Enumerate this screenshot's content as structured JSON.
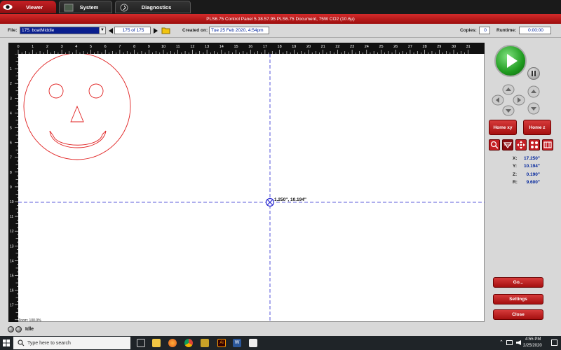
{
  "tabs": [
    {
      "label": "Viewer"
    },
    {
      "label": "System"
    },
    {
      "label": "Diagnostics"
    }
  ],
  "title": "PLS6.75  Control Panel   5.38.57.95     PLS6.75 Document, 75W CO2 (10.6μ)",
  "infobar": {
    "file_label": "File:",
    "file_value": "175. boatMiddle",
    "page_value": "175 of 175",
    "created_label": "Created on:",
    "created_value": "Tue 25 Feb 2020,  4:54pm",
    "copies_label": "Copies:",
    "copies_value": "0",
    "runtime_label": "Runtime:",
    "runtime_value": "0:00:00"
  },
  "ruler_h": [
    "0",
    "1",
    "2",
    "3",
    "4",
    "5",
    "6",
    "7",
    "8",
    "9",
    "10",
    "11",
    "12",
    "13",
    "14",
    "15",
    "16",
    "17",
    "18",
    "19",
    "20",
    "21",
    "22",
    "23",
    "24",
    "25",
    "26",
    "27",
    "28",
    "29",
    "30",
    "31"
  ],
  "ruler_v": [
    "1",
    "2",
    "3",
    "4",
    "5",
    "6",
    "7",
    "8",
    "9",
    "10",
    "11",
    "12",
    "13",
    "14",
    "15",
    "16",
    "17"
  ],
  "cursor_label": "1.250\", 10.194\"",
  "zoom_label": "Zoom:  100.0%",
  "status": "Idle",
  "buttons": {
    "home_xy": "Home xy",
    "home_z": "Home z",
    "go": "Go...",
    "settings": "Settings",
    "close": "Close"
  },
  "coords": {
    "x_label": "X:",
    "x_value": "17.250\"",
    "y_label": "Y:",
    "y_value": "10.194\"",
    "z_label": "Z:",
    "z_value": "0.190\"",
    "r_label": "R:",
    "r_value": "9.600\""
  },
  "taskbar": {
    "search_placeholder": "Type here to search",
    "time": "4:55 PM",
    "date": "2/25/2020"
  },
  "colors": {
    "accent_red": "#c41e24",
    "value_blue": "#00249c",
    "drawing_red": "#e02020",
    "crosshair_blue": "#2a2ad0"
  }
}
